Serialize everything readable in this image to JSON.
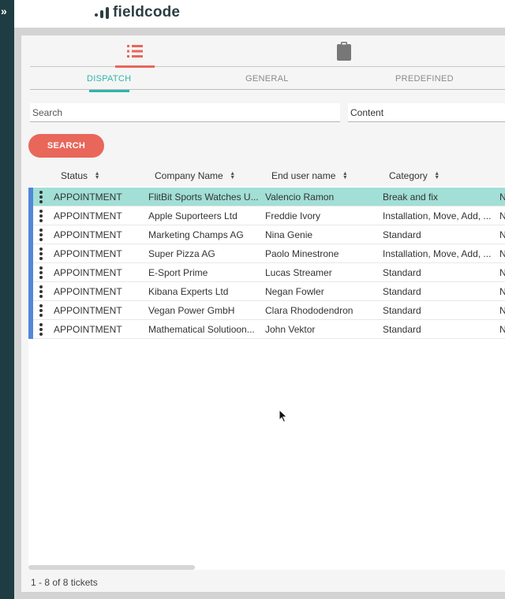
{
  "sidebar": {
    "expand_icon": "double-chevron-right-icon",
    "expand_glyph": "»"
  },
  "header": {
    "logo_text": "fieldcode"
  },
  "icon_tabs": [
    {
      "icon": "list-icon",
      "active": true
    },
    {
      "icon": "clipboard-icon",
      "active": false
    }
  ],
  "tabs": [
    {
      "label": "DISPATCH",
      "active": true
    },
    {
      "label": "GENERAL",
      "active": false
    },
    {
      "label": "PREDEFINED",
      "active": false
    }
  ],
  "search": {
    "placeholder": "Search",
    "value": ""
  },
  "content_select": {
    "value": "Content"
  },
  "search_button": {
    "label": "SEARCH"
  },
  "table": {
    "columns": [
      {
        "label": "Status",
        "sortable": true
      },
      {
        "label": "Company Name",
        "sortable": true
      },
      {
        "label": "End user name",
        "sortable": true
      },
      {
        "label": "Category",
        "sortable": true
      }
    ],
    "rows": [
      {
        "status": "APPOINTMENT",
        "company": "FlitBit Sports Watches U...",
        "end_user": "Valencio Ramon",
        "category": "Break and fix",
        "extra": "N",
        "selected": true
      },
      {
        "status": "APPOINTMENT",
        "company": "Apple Suporteers Ltd",
        "end_user": "Freddie Ivory",
        "category": "Installation, Move, Add, ...",
        "extra": "N",
        "selected": false
      },
      {
        "status": "APPOINTMENT",
        "company": "Marketing Champs AG",
        "end_user": "Nina Genie",
        "category": "Standard",
        "extra": "N",
        "selected": false
      },
      {
        "status": "APPOINTMENT",
        "company": "Super Pizza AG",
        "end_user": "Paolo Minestrone",
        "category": "Installation, Move, Add, ...",
        "extra": "N",
        "selected": false
      },
      {
        "status": "APPOINTMENT",
        "company": "E-Sport Prime",
        "end_user": "Lucas Streamer",
        "category": "Standard",
        "extra": "N",
        "selected": false
      },
      {
        "status": "APPOINTMENT",
        "company": "Kibana Experts Ltd",
        "end_user": "Negan Fowler",
        "category": "Standard",
        "extra": "N",
        "selected": false
      },
      {
        "status": "APPOINTMENT",
        "company": "Vegan Power GmbH",
        "end_user": "Clara Rhododendron",
        "category": "Standard",
        "extra": "N",
        "selected": false
      },
      {
        "status": "APPOINTMENT",
        "company": "Mathematical Solutioon...",
        "end_user": "John Vektor",
        "category": "Standard",
        "extra": "N",
        "selected": false
      }
    ]
  },
  "footer": {
    "ticket_count": "1 - 8 of 8 tickets"
  },
  "colors": {
    "accent": "#e8675a",
    "teal": "#2db7a8",
    "selected_row": "#a2dfd6",
    "row_marker": "#5287d9",
    "sidebar": "#1d3d42"
  }
}
